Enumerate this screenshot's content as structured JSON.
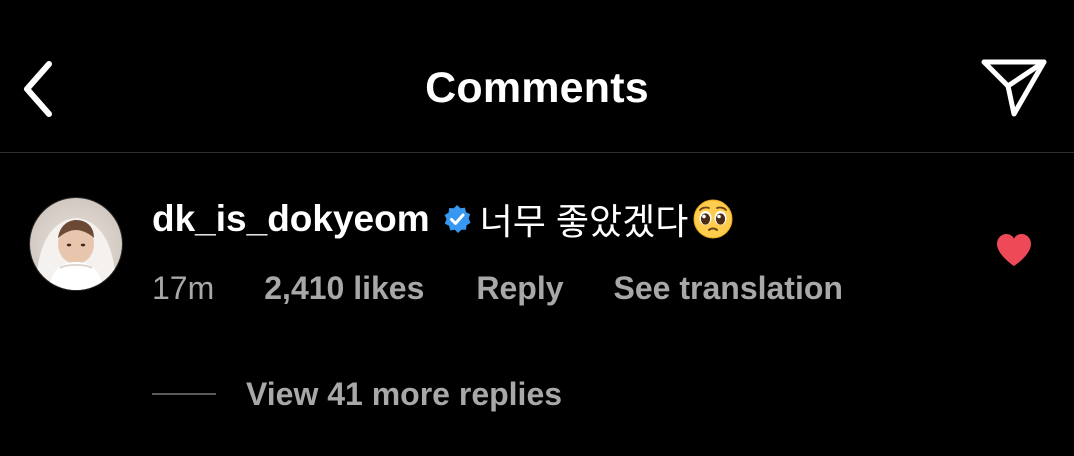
{
  "header": {
    "title": "Comments",
    "back_icon": "chevron-left-icon",
    "share_icon": "paper-plane-icon"
  },
  "comment": {
    "username": "dk_is_dokyeom",
    "verified": true,
    "text": "너무 좋았겠다",
    "emoji": "pleading-face-emoji",
    "time": "17m",
    "likes": "2,410 likes",
    "reply_label": "Reply",
    "translation_label": "See translation",
    "liked": true
  },
  "replies": {
    "label": "View 41 more replies"
  },
  "colors": {
    "background": "#000000",
    "text": "#ffffff",
    "muted": "#a8a8a8",
    "verified": "#3897f0",
    "like": "#ed4956"
  }
}
